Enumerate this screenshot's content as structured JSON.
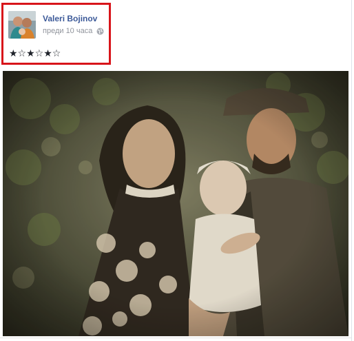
{
  "post": {
    "author": "Valeri Bojinov",
    "timestamp": "преди 10 часа",
    "privacy_icon": "globe-icon",
    "rating_text": "★☆★☆★☆",
    "avatar_icon": "profile-avatar",
    "photo_icon": "family-photo"
  },
  "colors": {
    "highlight": "#d8141a",
    "author_link": "#3b5998",
    "meta_text": "#90949c"
  }
}
